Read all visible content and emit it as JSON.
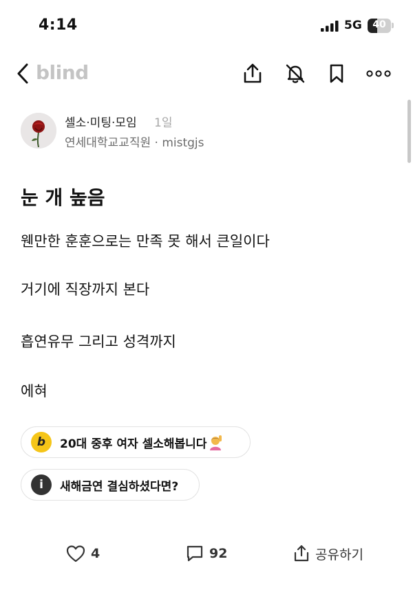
{
  "status_bar": {
    "time": "4:14",
    "network": "5G",
    "battery": "40",
    "battery_level": 0.4
  },
  "nav": {
    "logo": "blind",
    "back_icon": "chevron-left-icon",
    "share_icon": "share-icon",
    "bell_icon": "bell-off-icon",
    "bookmark_icon": "bookmark-icon",
    "more_icon": "more-horizontal-icon"
  },
  "author": {
    "board": "셀소·미팅·모임",
    "age": "1일",
    "affiliation": "연세대학교교직원 · mistgjs",
    "avatar_icon": "rose-avatar"
  },
  "post": {
    "title": "눈 개 높음",
    "paragraphs": [
      "웬만한 훈훈으로는 만족 못 해서 큰일이다",
      "거기에 직장까지 본다",
      "흡연유무 그리고 성격까지",
      "에혀"
    ]
  },
  "chips": [
    {
      "badge": "b",
      "text": "20대 중후 여자 셀소해봅니다",
      "emoji": "woman-raising-hand-emoji"
    },
    {
      "badge": "i",
      "text": "새해금연 결심하셨다면?"
    }
  ],
  "actions": {
    "likes": "4",
    "comments": "92",
    "share": "공유하기"
  }
}
